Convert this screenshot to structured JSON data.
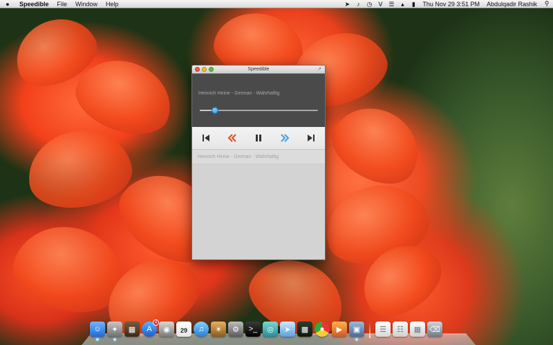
{
  "menubar": {
    "apple_glyph": "",
    "app_name": "Speedible",
    "menus": [
      "File",
      "Window",
      "Help"
    ],
    "status": {
      "date_time": "Thu Nov 29  3:51 PM",
      "user": "Abdulqadir Rashik"
    }
  },
  "window": {
    "title": "Speedible",
    "now_playing": {
      "track": "Heinrich Heine - German - Wahrhaftig",
      "progress": 0.13
    },
    "playlist": [
      {
        "label": "Heinrich Heine - German - Wahrhaftig"
      }
    ]
  },
  "dock": {
    "calendar_day": "29",
    "app_store_badge": "4"
  },
  "colors": {
    "accent": "#2b95e6",
    "rewind": "#e04a1c",
    "fast_forward": "#3aa0e8"
  }
}
